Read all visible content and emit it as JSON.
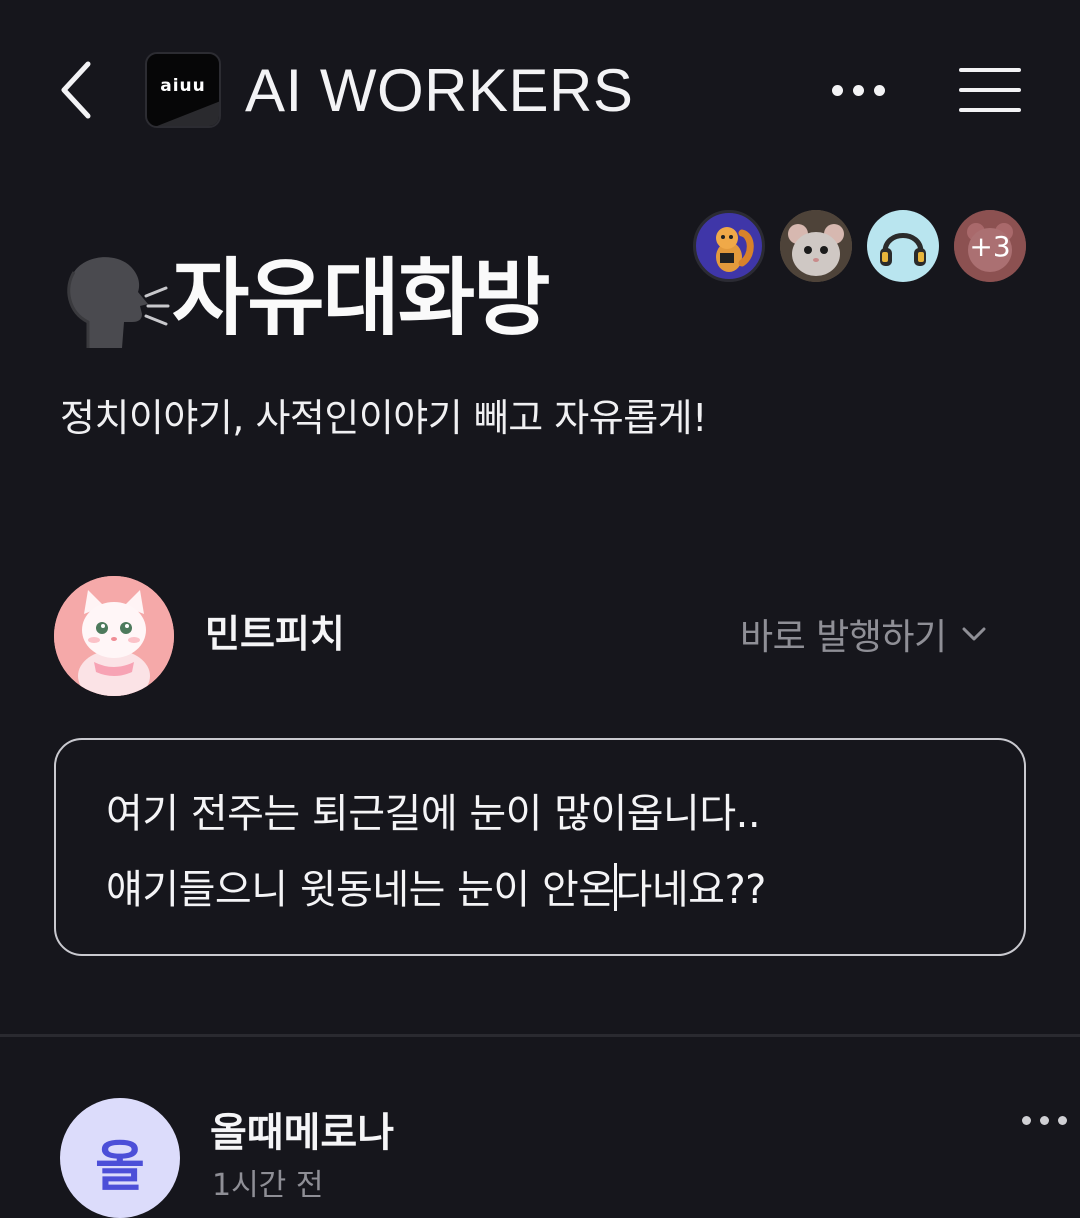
{
  "header": {
    "logo_text": "aiuu",
    "brand_title": "AI WORKERS",
    "back_icon": "chevron-left-icon",
    "more_icon": "more-horizontal-icon",
    "menu_icon": "hamburger-menu-icon"
  },
  "members": {
    "extra_count": "+3",
    "avatars": [
      "squirrel-avatar",
      "hamster-avatar",
      "headphones-avatar",
      "pink-bear-avatar"
    ]
  },
  "room": {
    "icon": "speaking-head-emoji",
    "title": "자유대화방",
    "description": "정치이야기, 사적인이야기 빼고 자유롭게!"
  },
  "composer": {
    "author_name": "민트피치",
    "publish_label": "바로 발행하기",
    "line1": "여기 전주는 퇴근길에 눈이 많이옵니다..",
    "line2_before_caret": "얘기들으니 윗동네는 눈이 안온",
    "line2_after_caret": "다네요??"
  },
  "next_post": {
    "avatar_text": "올",
    "author_name": "올때메로나",
    "time": "1시간 전"
  },
  "colors": {
    "background": "#16161c",
    "text": "#f2f2f4",
    "muted": "#8f8f96",
    "accent_avatar": "#4c4fd8"
  }
}
